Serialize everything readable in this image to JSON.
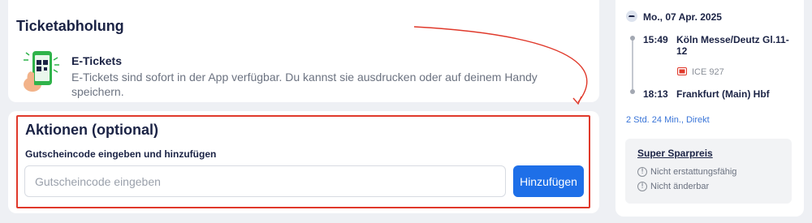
{
  "ticket_pickup": {
    "title": "Ticketabholung",
    "eticket_title": "E-Tickets",
    "eticket_description": "E-Tickets sind sofort in der App verfügbar. Du kannst sie ausdrucken oder auf deinem Handy speichern."
  },
  "actions": {
    "title": "Aktionen (optional)",
    "voucher_label": "Gutscheincode eingeben und hinzufügen",
    "voucher_placeholder": "Gutscheincode eingeben",
    "voucher_value": "",
    "add_button_label": "Hinzufügen"
  },
  "journey": {
    "date": "Mo., 07 Apr. 2025",
    "departure_time": "15:49",
    "departure_station": "Köln Messe/Deutz Gl.11-12",
    "train_number": "ICE 927",
    "arrival_time": "18:13",
    "arrival_station": "Frankfurt (Main) Hbf",
    "duration": "2 Std. 24 Min., Direkt"
  },
  "fare": {
    "name": "Super Sparpreis",
    "conditions": [
      "Nicht erstattungsfähig",
      "Nicht änderbar"
    ]
  },
  "colors": {
    "accent_blue": "#1e6fe8",
    "highlight_red": "#e0392b",
    "phone_green": "#2fb34a",
    "text_dark": "#1b2345"
  },
  "icons": {
    "phone": "phone-qr-icon",
    "train": "train-icon",
    "train_badge": "db-train-icon",
    "info": "info-icon"
  }
}
